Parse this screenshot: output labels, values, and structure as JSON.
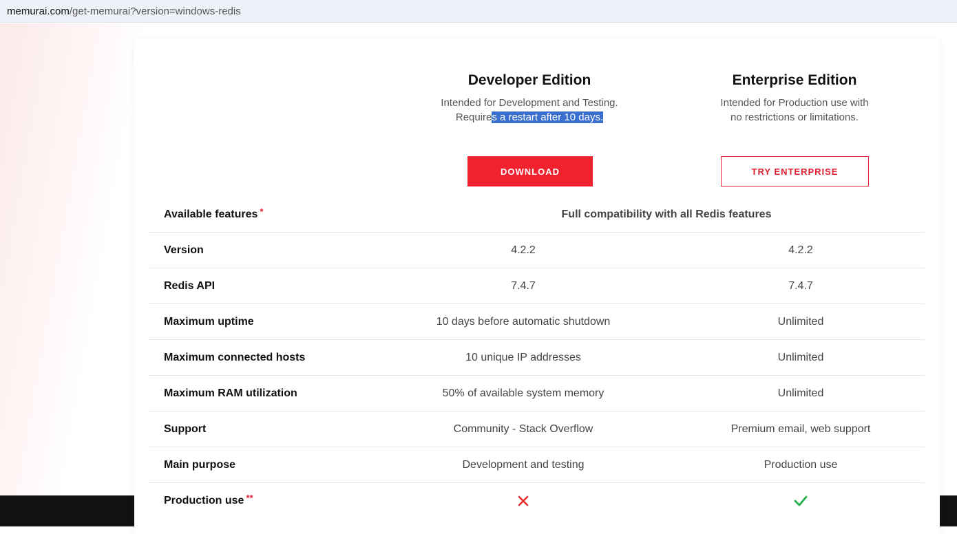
{
  "browser": {
    "url_host": "memurai.com",
    "url_path": "/get-memurai?version=windows-redis"
  },
  "editions": {
    "developer": {
      "title": "Developer Edition",
      "desc_line1": "Intended for Development and Testing.",
      "desc_line2_pre": "Require",
      "desc_line2_selected": "s a restart after 10 days.",
      "button": "DOWNLOAD"
    },
    "enterprise": {
      "title": "Enterprise Edition",
      "desc_line1": "Intended for Production use with",
      "desc_line2": "no restrictions or limitations.",
      "button": "TRY ENTERPRISE"
    }
  },
  "features": {
    "available_label": "Available features",
    "available_star": "*",
    "available_value": "Full compatibility with all Redis features",
    "rows": [
      {
        "label": "Version",
        "developer": "4.2.2",
        "enterprise": "4.2.2"
      },
      {
        "label": "Redis API",
        "developer": "7.4.7",
        "enterprise": "7.4.7"
      },
      {
        "label": "Maximum uptime",
        "developer": "10 days before automatic shutdown",
        "enterprise": "Unlimited"
      },
      {
        "label": "Maximum connected hosts",
        "developer": "10 unique IP addresses",
        "enterprise": "Unlimited"
      },
      {
        "label": "Maximum RAM utilization",
        "developer": "50% of available system memory",
        "enterprise": "Unlimited"
      },
      {
        "label": "Support",
        "developer": "Community - Stack Overflow",
        "enterprise": "Premium email, web support"
      },
      {
        "label": "Main purpose",
        "developer": "Development and testing",
        "enterprise": "Production use"
      }
    ],
    "production_label": "Production use",
    "production_star": "**",
    "production_developer_icon": "cross-icon",
    "production_enterprise_icon": "check-icon"
  },
  "colors": {
    "accent_red": "#f0222f",
    "check_green": "#22b14c",
    "selection_blue": "#3a6fd0"
  }
}
